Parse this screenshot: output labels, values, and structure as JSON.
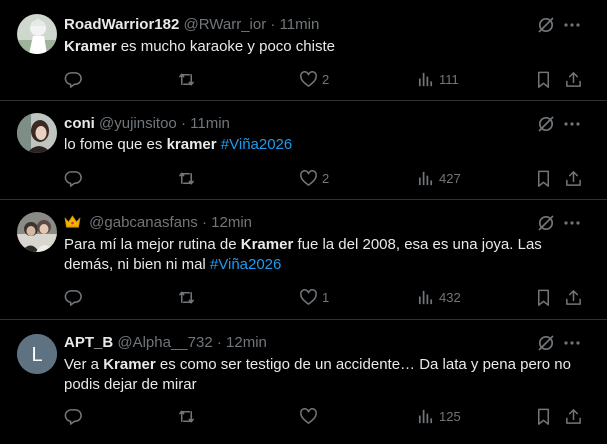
{
  "colors": {
    "background": "#000000",
    "text": "#e7e9ea",
    "muted": "#71767b",
    "link": "#1d9bf0",
    "divider": "#2f3336"
  },
  "tweets": [
    {
      "name": "RoadWarrior182",
      "handle": "@RWarr_ior",
      "separator": "·",
      "time": "11min",
      "text_parts": [
        {
          "t": "Kramer",
          "bold": true
        },
        {
          "t": " es mucho karaoke y poco chiste"
        }
      ],
      "replies": "",
      "retweets": "",
      "likes": "2",
      "views": "111"
    },
    {
      "name": "coni",
      "handle": "@yujinsitoo",
      "separator": "·",
      "time": "11min",
      "text_parts": [
        {
          "t": "lo fome que es "
        },
        {
          "t": "kramer",
          "bold": true
        },
        {
          "t": " "
        },
        {
          "t": "#Viña2026",
          "tag": true
        }
      ],
      "replies": "",
      "retweets": "",
      "likes": "2",
      "views": "427"
    },
    {
      "name": "👑",
      "handle": "@gabcanasfans",
      "separator": "·",
      "time": "12min",
      "text_parts": [
        {
          "t": "Para mí la mejor rutina de "
        },
        {
          "t": "Kramer",
          "bold": true
        },
        {
          "t": " fue la del 2008, esa es una joya. Las demás, ni bien ni mal "
        },
        {
          "t": "#Viña2026",
          "tag": true
        }
      ],
      "replies": "",
      "retweets": "",
      "likes": "1",
      "views": "432"
    },
    {
      "name": "APT_B",
      "handle": "@Alpha__732",
      "separator": "·",
      "time": "12min",
      "avatar_letter": "L",
      "text_parts": [
        {
          "t": "Ver a "
        },
        {
          "t": "Kramer",
          "bold": true
        },
        {
          "t": " es como ser testigo de un accidente… Da lata y pena pero no podis dejar de mirar"
        }
      ],
      "replies": "",
      "retweets": "",
      "likes": "",
      "views": "125"
    }
  ]
}
